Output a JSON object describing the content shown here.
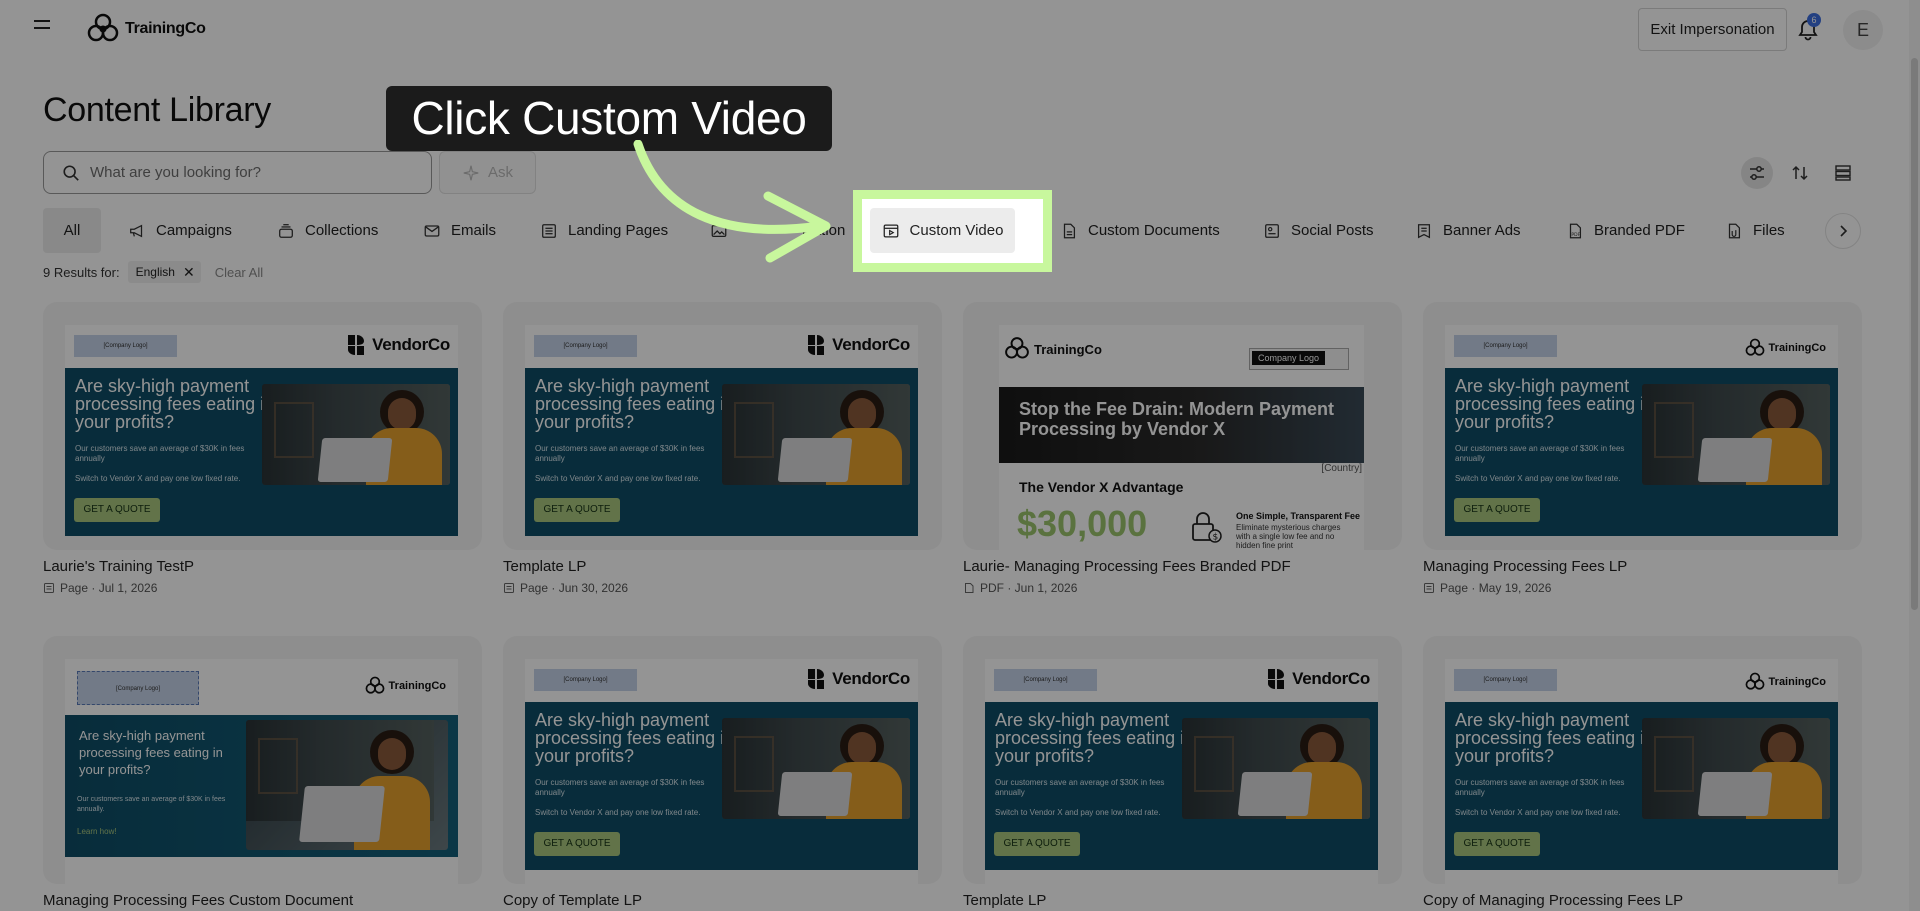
{
  "header": {
    "logo_text": "TrainingCo",
    "exit_label": "Exit Impersonation",
    "notification_count": "6",
    "avatar_initial": "E"
  },
  "page": {
    "title": "Content Library",
    "search_placeholder": "What are you looking for?",
    "ask_label": "Ask"
  },
  "tabs": [
    {
      "label": "All",
      "icon": "grid-icon"
    },
    {
      "label": "Campaigns",
      "icon": "megaphone-icon"
    },
    {
      "label": "Collections",
      "icon": "stack-icon"
    },
    {
      "label": "Emails",
      "icon": "envelope-icon"
    },
    {
      "label": "Landing Pages",
      "icon": "page-icon"
    },
    {
      "label": "ication",
      "icon": "image-icon"
    },
    {
      "label": "Custom Video",
      "icon": "video-icon"
    },
    {
      "label": "Custom Documents",
      "icon": "document-icon"
    },
    {
      "label": "Social Posts",
      "icon": "social-icon"
    },
    {
      "label": "Banner Ads",
      "icon": "banner-icon"
    },
    {
      "label": "Branded PDF",
      "icon": "pdf-icon"
    },
    {
      "label": "Files",
      "icon": "file-icon"
    }
  ],
  "results": {
    "count_label": "9 Results for:",
    "filter_chip": "English",
    "clear_label": "Clear All"
  },
  "ad": {
    "company_logo": "[Company Logo]",
    "vendor": "VendorCo",
    "trainingco": "TrainingCo",
    "headline": "Are sky-high payment processing fees eating in your profits?",
    "sub": "Our customers save an average of $30K in fees annually",
    "sub2": "Switch to Vendor X and pay one low fixed rate.",
    "cta": "GET A QUOTE",
    "doc_sub": "Our customers save an average of $30K in fees annually.",
    "doc_link": "Learn how!"
  },
  "pdf": {
    "company_logo": "Company Logo",
    "hero": "Stop the Fee Drain: Modern Payment Processing by Vendor X",
    "country": "[Country]",
    "advantage": "The Vendor X Advantage",
    "amount": "$30,000",
    "fee_title": "One Simple, Transparent Fee",
    "fee_sub": "Eliminate mysterious charges with a single low fee and no hidden fine print"
  },
  "cards": [
    {
      "title": "Laurie's Training TestP",
      "meta": "Page · Jul 1, 2026"
    },
    {
      "title": "Template LP",
      "meta": "Page · Jun 30, 2026"
    },
    {
      "title": "Laurie- Managing Processing Fees Branded PDF",
      "meta": "PDF · Jun 1, 2026"
    },
    {
      "title": "Managing Processing Fees LP",
      "meta": "Page · May 19, 2026"
    },
    {
      "title": "Managing Processing Fees Custom Document",
      "meta": ""
    },
    {
      "title": "Copy of Template LP",
      "meta": ""
    },
    {
      "title": "Template LP",
      "meta": ""
    },
    {
      "title": "Copy of Managing Processing Fees LP",
      "meta": ""
    }
  ],
  "callout": {
    "text": "Click Custom Video"
  },
  "colors": {
    "highlight": "#c8f79d",
    "ad_teal": "#0e4d66",
    "cta_green": "#a9c77e"
  }
}
